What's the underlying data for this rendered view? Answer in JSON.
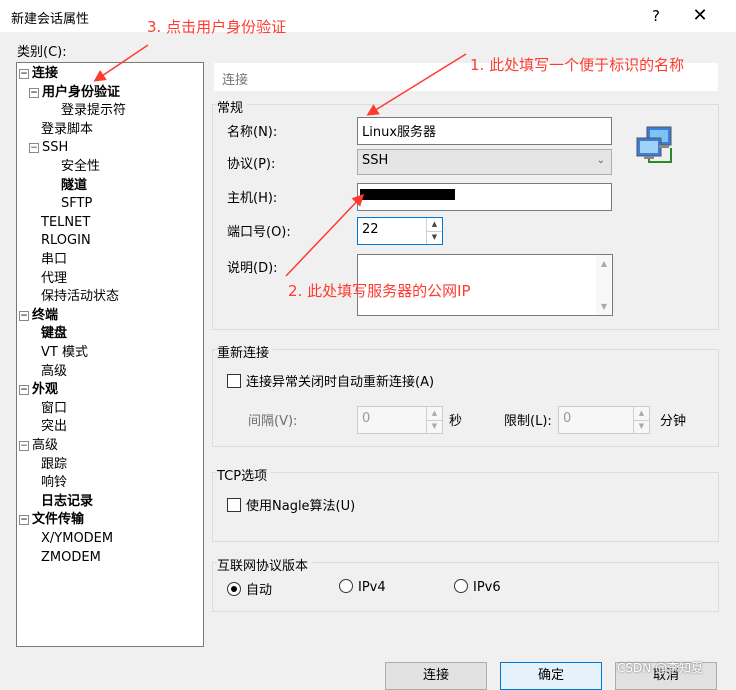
{
  "window": {
    "title": "新建会话属性",
    "help_label": "?",
    "close_label": "✕"
  },
  "category_label": "类别(C):",
  "tree": [
    {
      "label": "连接",
      "bold": true,
      "expander": "−",
      "indent": 0
    },
    {
      "label": "用户身份验证",
      "bold": true,
      "expander": "−",
      "indent": 1
    },
    {
      "label": "登录提示符",
      "bold": false,
      "expander": "",
      "indent": 2
    },
    {
      "label": "登录脚本",
      "bold": false,
      "expander": "",
      "indent": 1
    },
    {
      "label": "SSH",
      "bold": false,
      "expander": "−",
      "indent": 1
    },
    {
      "label": "安全性",
      "bold": false,
      "expander": "",
      "indent": 2
    },
    {
      "label": "隧道",
      "bold": true,
      "expander": "",
      "indent": 2
    },
    {
      "label": "SFTP",
      "bold": false,
      "expander": "",
      "indent": 2
    },
    {
      "label": "TELNET",
      "bold": false,
      "expander": "",
      "indent": 1
    },
    {
      "label": "RLOGIN",
      "bold": false,
      "expander": "",
      "indent": 1
    },
    {
      "label": "串口",
      "bold": false,
      "expander": "",
      "indent": 1
    },
    {
      "label": "代理",
      "bold": false,
      "expander": "",
      "indent": 1
    },
    {
      "label": "保持活动状态",
      "bold": false,
      "expander": "",
      "indent": 1
    },
    {
      "label": "终端",
      "bold": true,
      "expander": "−",
      "indent": 0
    },
    {
      "label": "键盘",
      "bold": true,
      "expander": "",
      "indent": 1
    },
    {
      "label": "VT 模式",
      "bold": false,
      "expander": "",
      "indent": 1
    },
    {
      "label": "高级",
      "bold": false,
      "expander": "",
      "indent": 1
    },
    {
      "label": "外观",
      "bold": true,
      "expander": "−",
      "indent": 0
    },
    {
      "label": "窗口",
      "bold": false,
      "expander": "",
      "indent": 1
    },
    {
      "label": "突出",
      "bold": false,
      "expander": "",
      "indent": 1
    },
    {
      "label": "高级",
      "bold": false,
      "expander": "−",
      "indent": 0
    },
    {
      "label": "跟踪",
      "bold": false,
      "expander": "",
      "indent": 1
    },
    {
      "label": "响铃",
      "bold": false,
      "expander": "",
      "indent": 1
    },
    {
      "label": "日志记录",
      "bold": true,
      "expander": "",
      "indent": 1
    },
    {
      "label": "文件传输",
      "bold": true,
      "expander": "−",
      "indent": 0
    },
    {
      "label": "X/YMODEM",
      "bold": false,
      "expander": "",
      "indent": 1
    },
    {
      "label": "ZMODEM",
      "bold": false,
      "expander": "",
      "indent": 1
    }
  ],
  "header": "连接",
  "general": {
    "title": "常规",
    "name_label": "名称(N):",
    "name_value": "Linux服务器",
    "protocol_label": "协议(P):",
    "protocol_value": "SSH",
    "host_label": "主机(H):",
    "port_label": "端口号(O):",
    "port_value": "22",
    "desc_label": "说明(D):"
  },
  "reconnect": {
    "title": "重新连接",
    "checkbox_label": "连接异常关闭时自动重新连接(A)",
    "interval_label": "间隔(V):",
    "interval_value": "0",
    "interval_unit": "秒",
    "limit_label": "限制(L):",
    "limit_value": "0",
    "limit_unit": "分钟"
  },
  "tcp": {
    "title": "TCP选项",
    "nagle_label": "使用Nagle算法(U)"
  },
  "ipver": {
    "title": "互联网协议版本",
    "auto": "自动",
    "ipv4": "IPv4",
    "ipv6": "IPv6"
  },
  "buttons": {
    "connect": "连接",
    "ok": "确定",
    "cancel": "取消"
  },
  "annotations": {
    "a1": "1. 此处填写一个便于标识的名称",
    "a2": "2. 此处填写服务器的公网IP",
    "a3": "3. 点击用户身份验证"
  },
  "watermark": "CSDN @李知夏",
  "colors": {
    "annotation": "#ff3b30",
    "focus": "#0078d7"
  }
}
